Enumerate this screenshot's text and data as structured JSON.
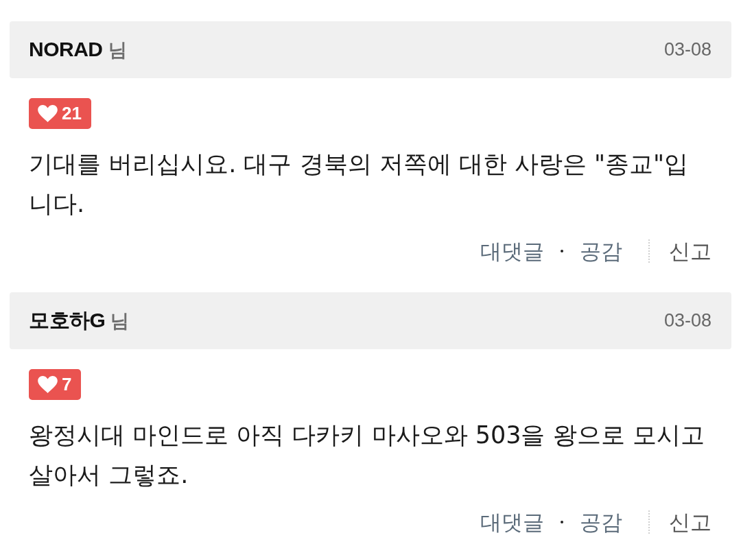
{
  "comments": [
    {
      "author": "NORAD",
      "honorific": "님",
      "date": "03-08",
      "likes": "21",
      "text": "기대를 버리십시요. 대구 경북의 저쪽에 대한 사랑은 \"종교\"입니다.",
      "actions": [
        {
          "kind": "reply",
          "label": "대댓글"
        },
        {
          "kind": "empathy",
          "label": "공감"
        },
        {
          "kind": "report",
          "label": "신고"
        }
      ]
    },
    {
      "author": "모호하G",
      "honorific": "님",
      "date": "03-08",
      "likes": "7",
      "text": "왕정시대 마인드로 아직 다카키 마사오와 503을 왕으로 모시고 살아서 그렇죠.",
      "actions": [
        {
          "kind": "reply",
          "label": "대댓글"
        },
        {
          "kind": "empathy",
          "label": "공감"
        },
        {
          "kind": "report",
          "label": "신고"
        }
      ]
    }
  ]
}
